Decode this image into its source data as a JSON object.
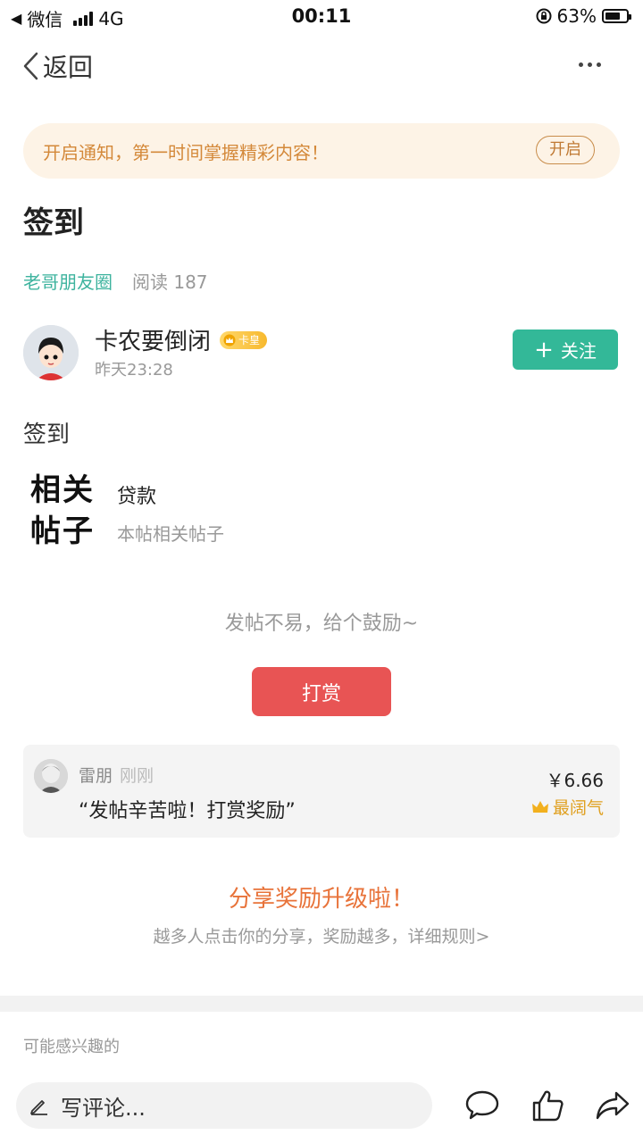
{
  "status_bar": {
    "carrier": "微信",
    "network": "4G",
    "time": "00:11",
    "battery": "63%"
  },
  "nav": {
    "back_label": "返回"
  },
  "notify": {
    "text": "开启通知，第一时间掌握精彩内容！",
    "button": "开启"
  },
  "post": {
    "title": "签到",
    "circle": "老哥朋友圈",
    "reads": "阅读 187",
    "body": "签到"
  },
  "author": {
    "name": "卡农要倒闭",
    "badge": "卡皇",
    "time": "昨天23:28",
    "follow_label": "关注"
  },
  "related": {
    "logo_line1": "相关",
    "logo_line2": "帖子",
    "tag": "贷款",
    "subtitle": "本帖相关帖子"
  },
  "reward": {
    "prompt": "发帖不易，给个鼓励~",
    "button": "打赏",
    "record": {
      "user": "雷朋",
      "time": "刚刚",
      "message": "“发帖辛苦啦！打赏奖励”",
      "amount": "￥6.66",
      "tag": "最阔气"
    }
  },
  "share": {
    "title": "分享奖励升级啦！",
    "subtitle": "越多人点击你的分享，奖励越多，详细规则>"
  },
  "maybe_interested": "可能感兴趣的",
  "bottom_bar": {
    "comment_placeholder": "写评论..."
  },
  "colors": {
    "green": "#33b898",
    "red": "#e85454",
    "orange": "#e8733a",
    "banner_bg": "#fdf3e6"
  }
}
